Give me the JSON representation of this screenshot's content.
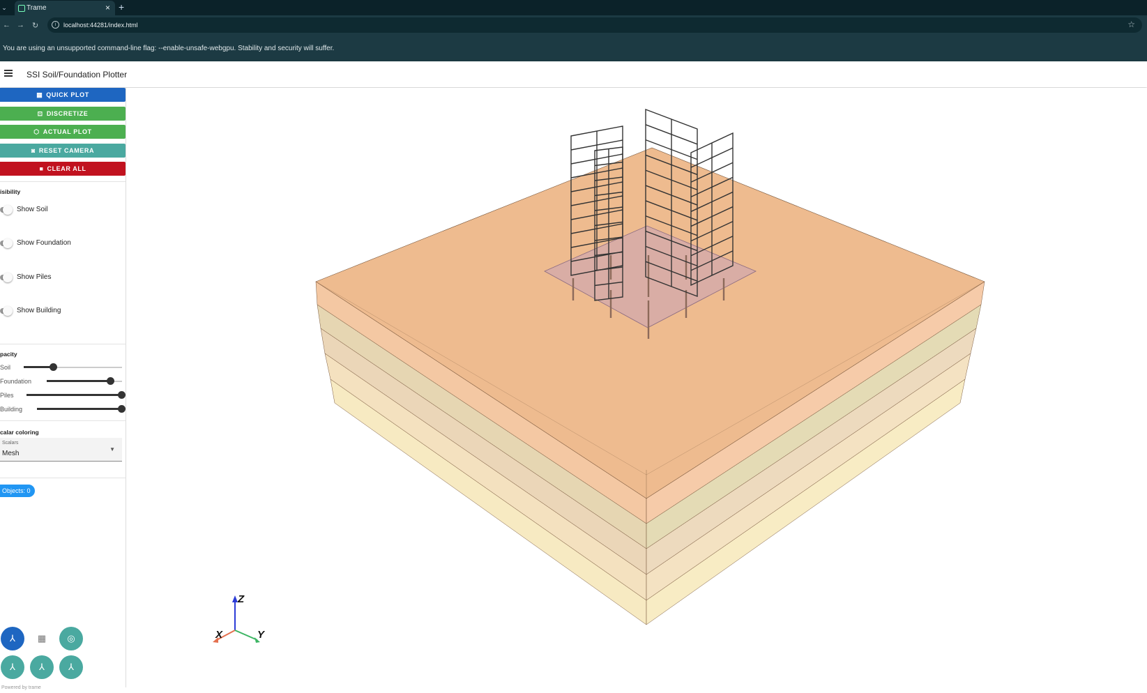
{
  "browser": {
    "tab_title": "Trame",
    "tab_close": "×",
    "new_tab": "+",
    "url": "localhost:44281/index.html",
    "back": "←",
    "forward": "→",
    "reload": "↻",
    "warning": "You are using an unsupported command-line flag: --enable-unsafe-webgpu. Stability and security will suffer."
  },
  "app": {
    "title": "SSI Soil/Foundation Plotter"
  },
  "actions": [
    {
      "label": "QUICK PLOT",
      "color": "#1e66c1",
      "icon": "chart-icon"
    },
    {
      "label": "DISCRETIZE",
      "color": "#4caf50",
      "icon": "grid-focus-icon"
    },
    {
      "label": "ACTUAL PLOT",
      "color": "#4caf50",
      "icon": "cube-icon"
    },
    {
      "label": "RESET CAMERA",
      "color": "#4aa9a0",
      "icon": "camera-icon"
    },
    {
      "label": "CLEAR ALL",
      "color": "#c1121f",
      "icon": "trash-icon"
    }
  ],
  "visibility": {
    "heading": "isibility",
    "toggles": [
      "Show Soil",
      "Show Foundation",
      "Show Piles",
      "Show Building"
    ]
  },
  "opacity": {
    "heading": "pacity",
    "sliders": [
      {
        "label": "Soil",
        "value": 0.3
      },
      {
        "label": "Foundation",
        "value": 0.85
      },
      {
        "label": "Piles",
        "value": 1.0
      },
      {
        "label": "Building",
        "value": 1.0
      }
    ]
  },
  "scalar": {
    "heading": "calar coloring",
    "field_label": "Scalars",
    "value": "Mesh"
  },
  "objects_chip": "Objects: 0",
  "axes": {
    "z": "Z",
    "x": "X",
    "y": "Y"
  },
  "powered": "Powered by trame",
  "colors": {
    "soil_layers": [
      "#e8a46a",
      "#efb784",
      "#e6c78f",
      "#e8c99a",
      "#f0d6a4",
      "#f6e9b0"
    ],
    "foundation": "#c9a3b8",
    "pile": "#8c6a5a",
    "building": "#333333"
  }
}
